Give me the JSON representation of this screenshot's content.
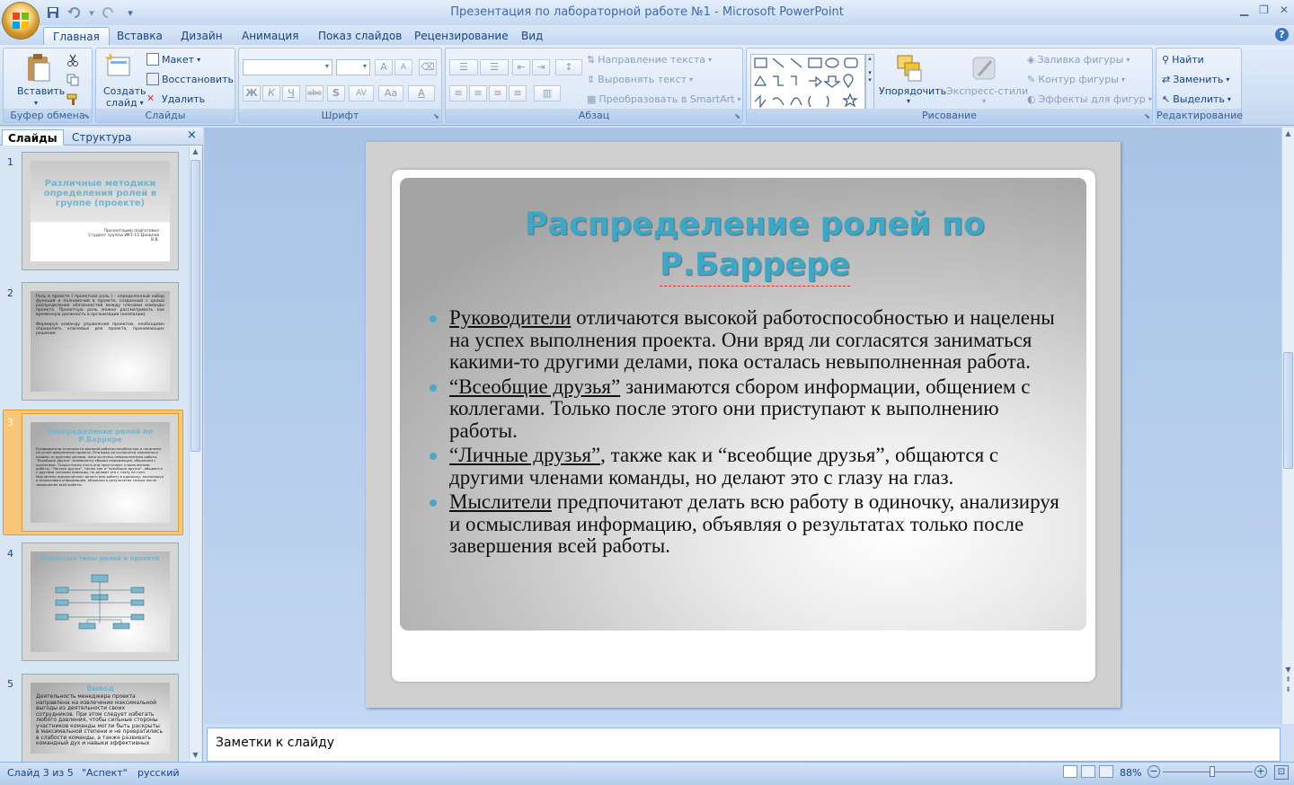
{
  "window": {
    "title": "Презентация по лабораторной работе №1 - Microsoft PowerPoint"
  },
  "tabs": [
    "Главная",
    "Вставка",
    "Дизайн",
    "Анимация",
    "Показ слайдов",
    "Рецензирование",
    "Вид"
  ],
  "ribbon": {
    "clipboard": {
      "label": "Буфер обмена",
      "paste": "Вставить"
    },
    "slides": {
      "label": "Слайды",
      "create": "Создать",
      "create2": "слайд",
      "layout": "Макет",
      "reset": "Восстановить",
      "delete": "Удалить"
    },
    "font": {
      "label": "Шрифт",
      "bold": "Ж",
      "italic": "К",
      "underline": "Ч",
      "strike": "abc",
      "shadow": "S",
      "spacing": "AV",
      "case": "Aa",
      "color": "A",
      "grow": "A",
      "shrink": "A"
    },
    "paragraph": {
      "label": "Абзац",
      "direction": "Направление текста",
      "align": "Выровнять текст",
      "smartart": "Преобразовать в SmartArt"
    },
    "drawing": {
      "label": "Рисование",
      "arrange": "Упорядочить",
      "styles": "Экспресс-стили",
      "fill": "Заливка фигуры",
      "outline": "Контур фигуры",
      "effects": "Эффекты для фигур"
    },
    "editing": {
      "label": "Редактирование",
      "find": "Найти",
      "replace": "Заменить",
      "select": "Выделить"
    }
  },
  "panel": {
    "tab_slides": "Слайды",
    "tab_outline": "Структура",
    "close": "×",
    "thumbs": [
      {
        "num": "1",
        "title": "Различные методики определения ролей в группе (проекте)",
        "sub": "Презентацию подготовил Студент группы ИКТ-15 Данилов В.В."
      },
      {
        "num": "2",
        "body": "Роль в проекте ( проектная роль ) - определенный набор функций и полномочий в проекте, созданный с целью распределения обязанностей между членами команды проекта. Проектную роль можно рассматривать как временную должность в организации (компании).",
        "body2": "Формируя команду управления проектом, необходимо определить ключевые для проекта, принимающих решения."
      },
      {
        "num": "3",
        "title": "Распределение ролей по Р.Баррере",
        "body": "Руководители отличаются высокой работоспособностью и нацелены на успех выполнения проекта. Они вряд ли согласятся заниматься какими-то другими делами, пока осталась невыполненная работа. “Всеобщие друзья” занимаются сбором информации, общением с коллегами. Только после этого они приступают к выполнению работы. “Личные друзья”, также как и “всеобщие друзья”, общаются с другими членами команды, но делают это с глазу на глаз. Мыслители предпочитают делать всю работу в одиночку, анализируя и осмысливая информацию, объявляя о результатах только после завершения всей работы."
      },
      {
        "num": "4",
        "title": "Основные типы ролей в проекте"
      },
      {
        "num": "5",
        "title": "Вывод",
        "body": "Деятельность менеджера проекта направлена на извлечение максимальной выгоды из деятельности своих сотрудников. При этом следует избегать любого давления, чтобы сильные стороны участников команды могли быть раскрыты в максимальной степени и не превратились в слабости команды, а также развивать командный дух и навыки эффективных"
      }
    ]
  },
  "slide": {
    "title_line1": "Распределение ролей по",
    "title_line2": "Р.Баррере",
    "bullets": [
      {
        "term": "Руководители",
        "text": " отличаются высокой работоспособностью и нацелены на успех выполнения проекта. Они вряд ли согласятся заниматься какими-то другими делами, пока осталась невыполненная работа."
      },
      {
        "term": "“Всеобщие друзья”",
        "text": "  занимаются сбором информации, общением с коллегами. Только после этого они приступают к выполнению работы."
      },
      {
        "term": "“Личные  друзья”",
        "text": ", также как и “всеобщие друзья”,  общаются с другими членами команды, но делают это с глазу на глаз."
      },
      {
        "term": "Мыслители",
        "text": "  предпочитают делать всю работу в одиночку, анализируя и осмысливая информацию, объявляя о результатах только после завершения всей работы."
      }
    ]
  },
  "notes": {
    "placeholder": "Заметки к слайду"
  },
  "status": {
    "slide": "Слайд 3 из 5",
    "theme": "\"Аспект\"",
    "lang": "русский",
    "zoom": "88%",
    "zoom_fraction": 0.55
  }
}
